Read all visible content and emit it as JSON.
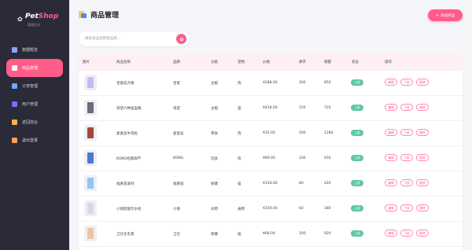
{
  "app": {
    "logo_pet": "Pet",
    "logo_shop": "Shop",
    "logo_sub": "管理后台"
  },
  "sidebar": {
    "items": [
      {
        "label": "数据概览",
        "icon": "chart-icon",
        "color": "#8aa4ff"
      },
      {
        "label": "商品管理",
        "icon": "box-icon",
        "color": "#ffffff",
        "active": true
      },
      {
        "label": "订单管理",
        "icon": "order-icon",
        "color": "#6fa8ff"
      },
      {
        "label": "用户管理",
        "icon": "users-icon",
        "color": "#7a6cff"
      },
      {
        "label": "返回前台",
        "icon": "home-icon",
        "color": "#ffb347"
      },
      {
        "label": "退出登录",
        "icon": "door-icon",
        "color": "#ff9f5a"
      }
    ]
  },
  "header": {
    "title": "商品管理",
    "add_label": "添加商品"
  },
  "search": {
    "placeholder": "搜索商品名称或品牌..."
  },
  "table": {
    "columns": [
      "图片",
      "商品名称",
      "品牌",
      "分类",
      "宠物",
      "价格",
      "库存",
      "销量",
      "状态",
      "操作"
    ],
    "rows": [
      {
        "name": "皇家成犬粮",
        "brand": "皇家",
        "category": "主粮",
        "pet": "狗",
        "price": "¥288.00",
        "stock": "200",
        "sales": "850",
        "status": "上架"
      },
      {
        "name": "渴望六种鱼猫粮",
        "brand": "渴望",
        "category": "主粮",
        "pet": "猫",
        "price": "¥458.00",
        "stock": "150",
        "sales": "720",
        "status": "上架"
      },
      {
        "name": "麦富迪牛肉粒",
        "brand": "麦富迪",
        "category": "零食",
        "pet": "狗",
        "price": "¥35.00",
        "stock": "500",
        "sales": "1284",
        "status": "上架"
      },
      {
        "name": "KONG经典葫芦",
        "brand": "KONG",
        "category": "玩具",
        "pet": "狗",
        "price": "¥89.00",
        "stock": "100",
        "sales": "650",
        "status": "上架"
      },
      {
        "name": "福来恩滴剂",
        "brand": "福来恩",
        "category": "保健",
        "pet": "猫",
        "price": "¥128.00",
        "stock": "80",
        "sales": "420",
        "status": "上架"
      },
      {
        "name": "小佩智能饮水机",
        "brand": "小佩",
        "category": "日用",
        "pet": "通用",
        "price": "¥259.00",
        "stock": "60",
        "sales": "380",
        "status": "上架"
      },
      {
        "name": "卫仕化毛膏",
        "brand": "卫仕",
        "category": "保健",
        "pet": "猫",
        "price": "¥68.00",
        "stock": "200",
        "sales": "920",
        "status": "上架"
      }
    ],
    "actions": [
      "编辑",
      "下架",
      "删除"
    ]
  },
  "colors": {
    "accent": "#ff5c8a",
    "sidebar_bg": "#2a2a38",
    "status_on": "#5fc7a0"
  }
}
